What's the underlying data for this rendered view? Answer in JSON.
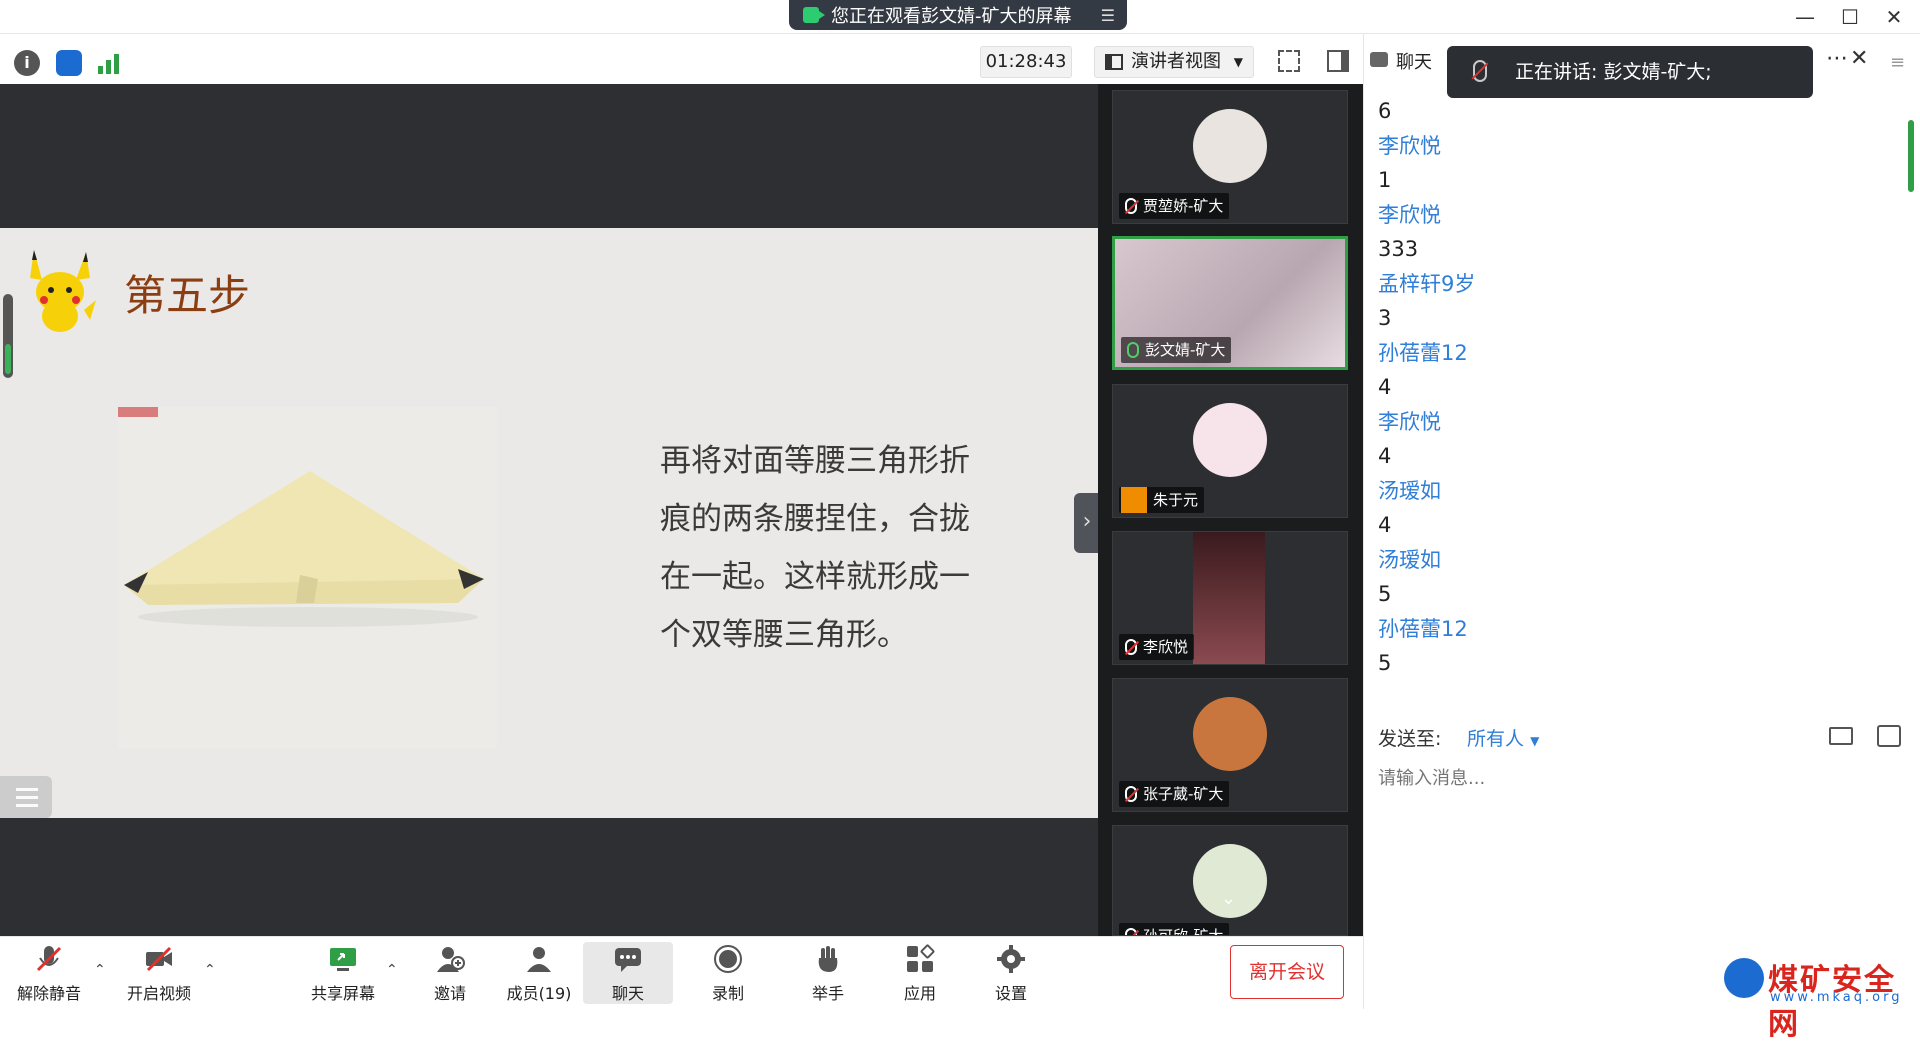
{
  "window": {
    "share_status": "您正在观看彭文婧-矿大的屏幕"
  },
  "toolbar": {
    "timer": "01:28:43",
    "view_mode": "演讲者视图",
    "icons": [
      "info-icon",
      "shield-icon",
      "signal-icon",
      "fullscreen-icon",
      "sidebar-icon"
    ]
  },
  "slide": {
    "title": "第五步",
    "body": "再将对面等腰三角形折痕的两条腰捏住，合拢在一起。这样就形成一个双等腰三角形。"
  },
  "participants": [
    {
      "name": "贾堃娇-矿大",
      "mic": "off",
      "avatar_color": "#e9e4e0"
    },
    {
      "name": "彭文婧-矿大",
      "mic": "on",
      "avatar_color": "#c9b9c3",
      "active": true
    },
    {
      "name": "朱于元",
      "mic": "none",
      "avatar_color": "#f7e3ea"
    },
    {
      "name": "李欣悦",
      "mic": "off",
      "avatar_color": "#7a3b40"
    },
    {
      "name": "张子葳-矿大",
      "mic": "off",
      "avatar_color": "#c9763e"
    },
    {
      "name": "孙可欣-矿大",
      "mic": "off",
      "avatar_color": "#dfe9d4"
    }
  ],
  "chat": {
    "header": "聊天",
    "speaking_banner": "正在讲话: 彭文婧-矿大;",
    "messages": [
      {
        "text": "6",
        "type": "msg"
      },
      {
        "text": "李欣悦",
        "type": "name"
      },
      {
        "text": "1",
        "type": "msg"
      },
      {
        "text": "李欣悦",
        "type": "name"
      },
      {
        "text": "333",
        "type": "msg"
      },
      {
        "text": "孟梓轩9岁",
        "type": "name"
      },
      {
        "text": "3",
        "type": "msg"
      },
      {
        "text": "孙蓓蕾12",
        "type": "name"
      },
      {
        "text": "4",
        "type": "msg"
      },
      {
        "text": "李欣悦",
        "type": "name"
      },
      {
        "text": "4",
        "type": "msg"
      },
      {
        "text": "汤瑷如",
        "type": "name"
      },
      {
        "text": "4",
        "type": "msg"
      },
      {
        "text": "汤瑷如",
        "type": "name"
      },
      {
        "text": "5",
        "type": "msg"
      },
      {
        "text": "孙蓓蕾12",
        "type": "name"
      },
      {
        "text": "5",
        "type": "msg"
      }
    ],
    "send_to_label": "发送至:",
    "send_to_value": "所有人",
    "input_placeholder": "请输入消息..."
  },
  "bottom_bar": {
    "unmute": "解除静音",
    "start_video": "开启视频",
    "share_screen": "共享屏幕",
    "invite": "邀请",
    "members": "成员(19)",
    "chat": "聊天",
    "record": "录制",
    "raise_hand": "举手",
    "apps": "应用",
    "settings": "设置",
    "leave": "离开会议"
  },
  "watermark": {
    "title": "煤矿安全网",
    "url": "www.mkaq.org"
  },
  "colors": {
    "accent_green": "#2f9e44",
    "link_blue": "#2f7ed8",
    "leave_red": "#e03131",
    "slide_title": "#8a3e12"
  }
}
